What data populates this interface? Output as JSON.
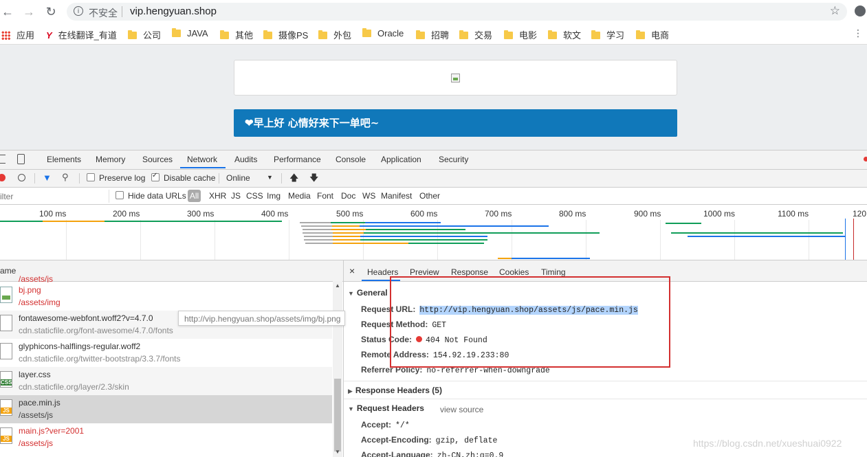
{
  "browser": {
    "nav": {
      "back": "←",
      "forward": "→",
      "reload": "↻"
    },
    "omnibox": {
      "info_icon": "i",
      "security_label": "不安全",
      "url": "vip.hengyuan.shop",
      "star": "☆"
    },
    "bookmarks": [
      "在线翻译_有道",
      "公司",
      "JAVA",
      "其他",
      "摄像PS",
      "外包",
      "Oracle",
      "招聘",
      "交易",
      "电影",
      "软文",
      "学习",
      "电商"
    ],
    "apps_label": "应用",
    "more": "⋮"
  },
  "page": {
    "greeting": "❤早上好 心情好来下一单吧~"
  },
  "devtools": {
    "tabs": [
      "Elements",
      "Memory",
      "Sources",
      "Network",
      "Audits",
      "Performance",
      "Console",
      "Application",
      "Security"
    ],
    "active_tab": "Network",
    "toolbar": {
      "preserve_log": "Preserve log",
      "disable_cache": "Disable cache",
      "throttle": "Online",
      "throttle_arrow": "▼",
      "upload": "🡅",
      "download": "🡇"
    },
    "filter": {
      "placeholder": "ilter",
      "hide_data_urls": "Hide data URLs",
      "types": [
        "All",
        "XHR",
        "JS",
        "CSS",
        "Img",
        "Media",
        "Font",
        "Doc",
        "WS",
        "Manifest",
        "Other"
      ]
    },
    "timeline": {
      "ticks": [
        "100 ms",
        "200 ms",
        "300 ms",
        "400 ms",
        "500 ms",
        "600 ms",
        "700 ms",
        "800 ms",
        "900 ms",
        "1000 ms",
        "1100 ms",
        "120"
      ]
    },
    "requests": {
      "column_name": "ame",
      "rows": [
        {
          "name": "",
          "path": "/assets/js",
          "icon": "",
          "error": true
        },
        {
          "name": "bj.png",
          "path": "/assets/img",
          "icon": "img",
          "error": true
        },
        {
          "name": "fontawesome-webfont.woff2?v=4.7.0",
          "path": "cdn.staticfile.org/font-awesome/4.7.0/fonts",
          "icon": "",
          "error": false
        },
        {
          "name": "glyphicons-halflings-regular.woff2",
          "path": "cdn.staticfile.org/twitter-bootstrap/3.3.7/fonts",
          "icon": "",
          "error": false
        },
        {
          "name": "layer.css",
          "path": "cdn.staticfile.org/layer/2.3/skin",
          "icon": "CSS",
          "error": false
        },
        {
          "name": "pace.min.js",
          "path": "/assets/js",
          "icon": "JS",
          "error": false
        },
        {
          "name": "main.js?ver=2001",
          "path": "/assets/js",
          "icon": "JS",
          "error": true
        }
      ],
      "tooltip": "http://vip.hengyuan.shop/assets/img/bj.png"
    },
    "detail": {
      "close": "×",
      "tabs": [
        "Headers",
        "Preview",
        "Response",
        "Cookies",
        "Timing"
      ],
      "general_title": "General",
      "general": [
        {
          "key": "Request URL:",
          "value": "http://vip.hengyuan.shop/assets/js/pace.min.js"
        },
        {
          "key": "Request Method:",
          "value": "GET"
        },
        {
          "key": "Status Code:",
          "value": "404 Not Found"
        },
        {
          "key": "Remote Address:",
          "value": "154.92.19.233:80"
        },
        {
          "key": "Referrer Policy:",
          "value": "no-referrer-when-downgrade"
        }
      ],
      "response_headers_title": "Response Headers (5)",
      "request_headers_title": "Request Headers",
      "view_source": "view source",
      "request_headers": [
        {
          "key": "Accept:",
          "value": "*/*"
        },
        {
          "key": "Accept-Encoding:",
          "value": "gzip, deflate"
        },
        {
          "key": "Accept-Language:",
          "value": "zh-CN,zh;q=0.9"
        }
      ]
    }
  },
  "watermark": "https://blog.csdn.net/xueshuai0922",
  "colors": {
    "accent": "#1a73e8",
    "greeting_bar": "#1078ba",
    "error": "#d32f2f",
    "annotation_box": "#d32f2f"
  }
}
